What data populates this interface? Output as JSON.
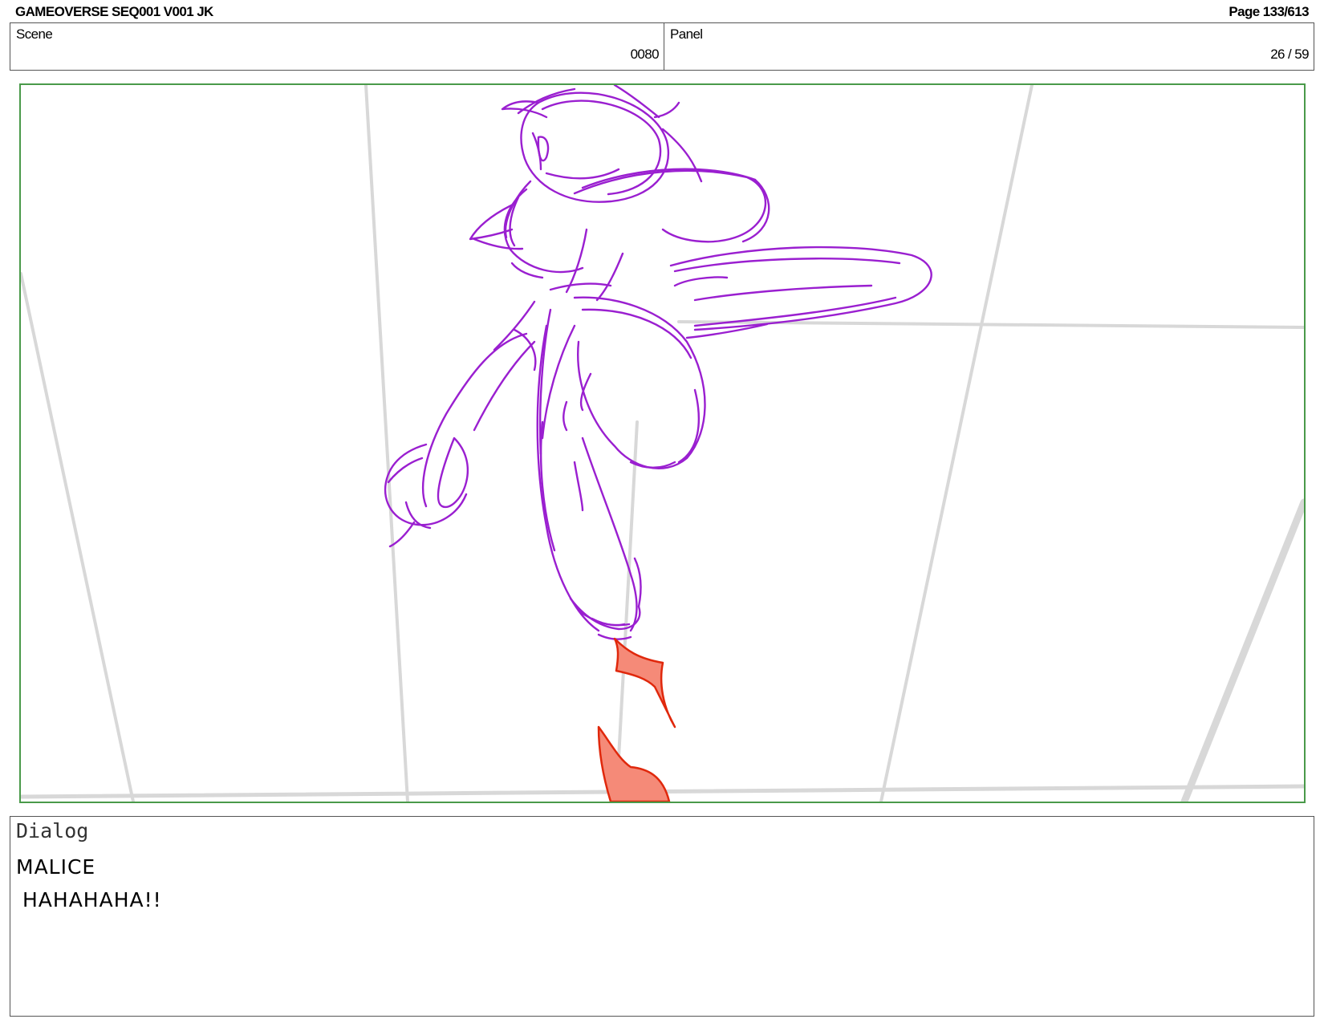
{
  "header": {
    "title": "GAMEOVERSE SEQ001 V001 JK",
    "page": "Page 133/613"
  },
  "info": {
    "scene_label": "Scene",
    "scene_value": "0080",
    "panel_label": "Panel",
    "panel_value": "26 / 59"
  },
  "dialog": {
    "label": "Dialog",
    "speaker": "MALICE",
    "line": "HAHAHAHA!!"
  },
  "colors": {
    "frame_border": "#4a9a4a",
    "sketch_stroke": "#9a1fd0",
    "effect_stroke": "#e0280c",
    "effect_fill": "#f58a78",
    "perspective_grid": "#d6d6d6"
  }
}
